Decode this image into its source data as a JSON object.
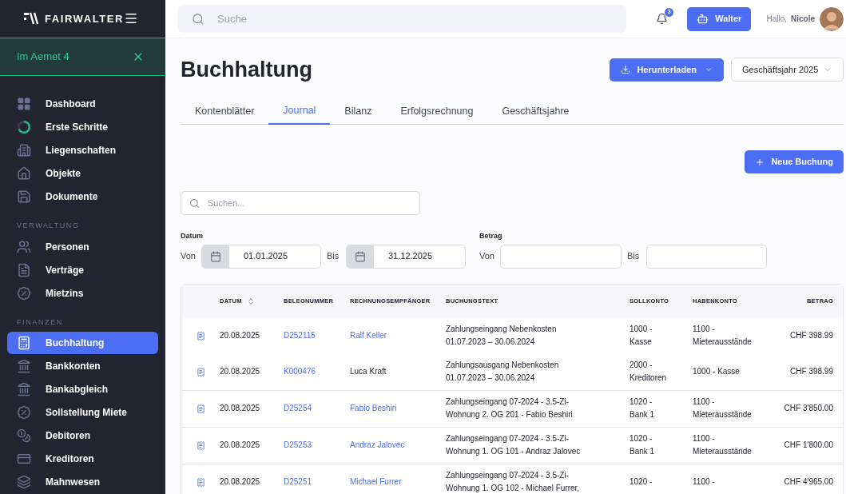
{
  "brand": {
    "name": "FAIRWALTER"
  },
  "property_banner": {
    "label": "Im Aemet 4"
  },
  "sidebar": {
    "sections": [
      {
        "items": [
          {
            "label": "Dashboard",
            "selected": false
          },
          {
            "label": "Erste Schritte",
            "selected": false
          },
          {
            "label": "Liegenschaften",
            "selected": false
          },
          {
            "label": "Objekte",
            "selected": false
          },
          {
            "label": "Dokumente",
            "selected": false
          }
        ]
      },
      {
        "heading": "VERWALTUNG",
        "items": [
          {
            "label": "Personen",
            "selected": false
          },
          {
            "label": "Verträge",
            "selected": false
          },
          {
            "label": "Mietzins",
            "selected": false
          }
        ]
      },
      {
        "heading": "FINANZEN",
        "items": [
          {
            "label": "Buchhaltung",
            "selected": true
          },
          {
            "label": "Bankkonten",
            "selected": false
          },
          {
            "label": "Bankabgleich",
            "selected": false
          },
          {
            "label": "Sollstellung Miete",
            "selected": false
          },
          {
            "label": "Debitoren",
            "selected": false
          },
          {
            "label": "Kreditoren",
            "selected": false
          },
          {
            "label": "Mahnwesen",
            "selected": false
          }
        ]
      }
    ]
  },
  "topbar": {
    "search_placeholder": "Suche",
    "notifications": "3",
    "assistant_button": "Walter",
    "greeting": "Hallo,",
    "user_name": "Nicole"
  },
  "page": {
    "title": "Buchhaltung",
    "download_button": "Herunterladen",
    "year_select": "Geschäftsjahr 2025"
  },
  "tabs": [
    {
      "label": "Kontenblätter",
      "selected": false
    },
    {
      "label": "Journal",
      "selected": true
    },
    {
      "label": "Bilanz",
      "selected": false
    },
    {
      "label": "Erfolgsrechnung",
      "selected": false
    },
    {
      "label": "Geschäftsjahre",
      "selected": false
    }
  ],
  "new_button": "Neue Buchung",
  "filter": {
    "search_placeholder": "Suchen...",
    "date_label": "Datum",
    "from_label": "Von",
    "to_label": "Bis",
    "date_from": "01.01.2025",
    "date_to": "31.12.2025",
    "amount_label": "Betrag",
    "amount_from_label": "Von",
    "amount_to_label": "Bis"
  },
  "table": {
    "columns": [
      "DATUM",
      "BELEGNUMMER",
      "RECHNUNGSEMPFÄNGER",
      "BUCHUNGSTEXT",
      "SOLLKONTO",
      "HABENKONTO",
      "BETRAG"
    ],
    "row_groups": [
      [
        {
          "datum": "20.08.2025",
          "beleg": "D252115",
          "empfaenger": "Ralf Keller",
          "empfaenger_link": true,
          "text": [
            "Zahlungseingang Nebenkosten",
            "01.07.2023 – 30.06.2024"
          ],
          "soll": [
            "1000 -",
            "Kasse"
          ],
          "haben": [
            "1100 -",
            "Mieterausstände"
          ],
          "betrag": "CHF 398.99"
        },
        {
          "datum": "20.08.2025",
          "beleg": "K000476",
          "empfaenger": "Luca Kraft",
          "empfaenger_link": false,
          "text": [
            "Zahlungsausgang Nebenkosten",
            "01.07.2023 – 30.06.2024"
          ],
          "soll": [
            "2000 -",
            "Kreditoren"
          ],
          "haben": [
            "1000 - Kasse"
          ],
          "betrag": "CHF 398.99"
        }
      ],
      [
        {
          "datum": "20.08.2025",
          "beleg": "D25254",
          "empfaenger": "Fabio Beshiri",
          "empfaenger_link": true,
          "text": [
            "Zahlungseingang 07-2024 - 3.5-Zi-",
            "Wohnung 2. OG 201 - Fabio Beshiri"
          ],
          "soll": [
            "1020 -",
            "Bank 1"
          ],
          "haben": [
            "1100 -",
            "Mieterausstände"
          ],
          "betrag": "CHF 3'850.00"
        }
      ],
      [
        {
          "datum": "20.08.2025",
          "beleg": "D25253",
          "empfaenger": "Andraz Jalovec",
          "empfaenger_link": true,
          "text": [
            "Zahlungseingang 07-2024 - 3.5-Zi-",
            "Wohnung 1. OG 101 - Andraz Jalovec"
          ],
          "soll": [
            "1020 -",
            "Bank 1"
          ],
          "haben": [
            "1100 -",
            "Mieterausstände"
          ],
          "betrag": "CHF 1'800.00"
        }
      ],
      [
        {
          "datum": "20.08.2025",
          "beleg": "D25251",
          "empfaenger": "Michael Furrer",
          "empfaenger_link": true,
          "text": [
            "Zahlungseingang 07-2024 - 3.5-Zi-",
            "Wohnung 1. OG 102 - Michael Furrer,"
          ],
          "soll": [
            "1020 -"
          ],
          "haben": [
            "1100 -"
          ],
          "betrag": "CHF 4'965.00"
        }
      ]
    ]
  }
}
